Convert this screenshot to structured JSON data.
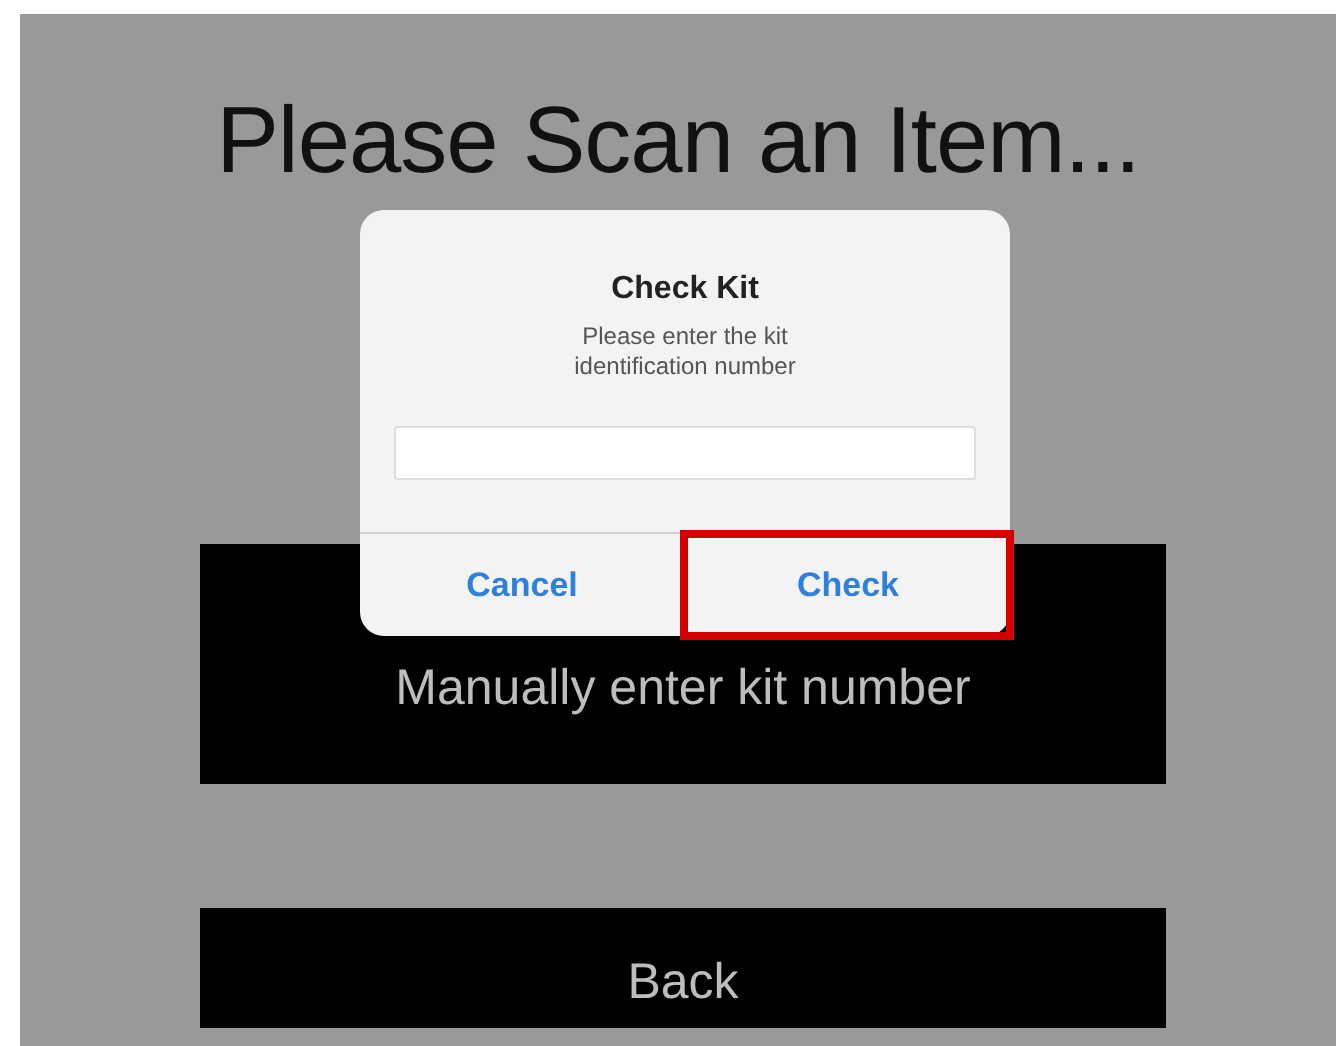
{
  "screen": {
    "title": "Please Scan an Item...",
    "buttons": [
      {
        "label": "Manually enter kit number"
      },
      {
        "label": "Back"
      }
    ]
  },
  "alert": {
    "title": "Check Kit",
    "message": "Please enter the kit identification number",
    "actions": [
      {
        "label": "Cancel",
        "highlighted": false
      },
      {
        "label": "Check",
        "highlighted": true
      }
    ]
  }
}
